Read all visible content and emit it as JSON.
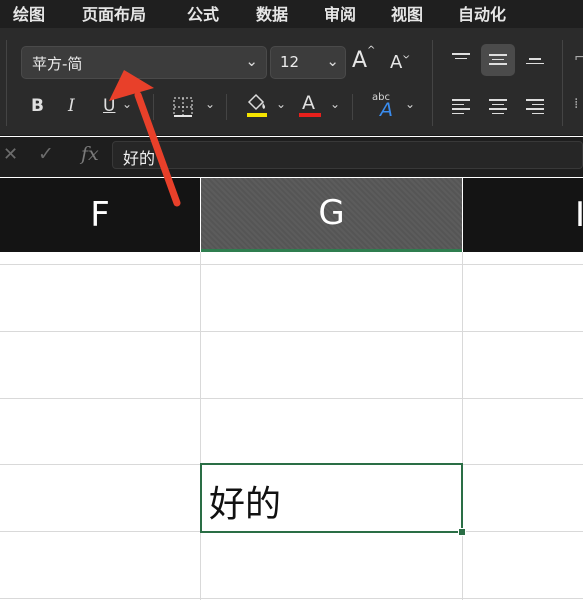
{
  "tabs": [
    "绘图",
    "页面布局",
    "公式",
    "数据",
    "审阅",
    "视图",
    "自动化"
  ],
  "font": {
    "name": "苹方-简",
    "size": "12",
    "grow_label": "A",
    "shrink_label": "A"
  },
  "format": {
    "bold": "B",
    "italic": "I",
    "underline": "U",
    "font_color_label": "A",
    "fill_color": "#f5e400",
    "font_color": "#e8201c",
    "orientation_top": "abc",
    "orientation_letter": "A"
  },
  "formula_bar": {
    "cancel": "✕",
    "confirm": "✓",
    "fx": "fx",
    "value": "好的"
  },
  "columns": [
    "F",
    "G",
    "I"
  ],
  "selected_cell": {
    "column": "G",
    "value": "好的"
  },
  "colors": {
    "selection": "#2a6e45",
    "arrow": "#e8402a",
    "ribbon": "#2b2b2b"
  }
}
